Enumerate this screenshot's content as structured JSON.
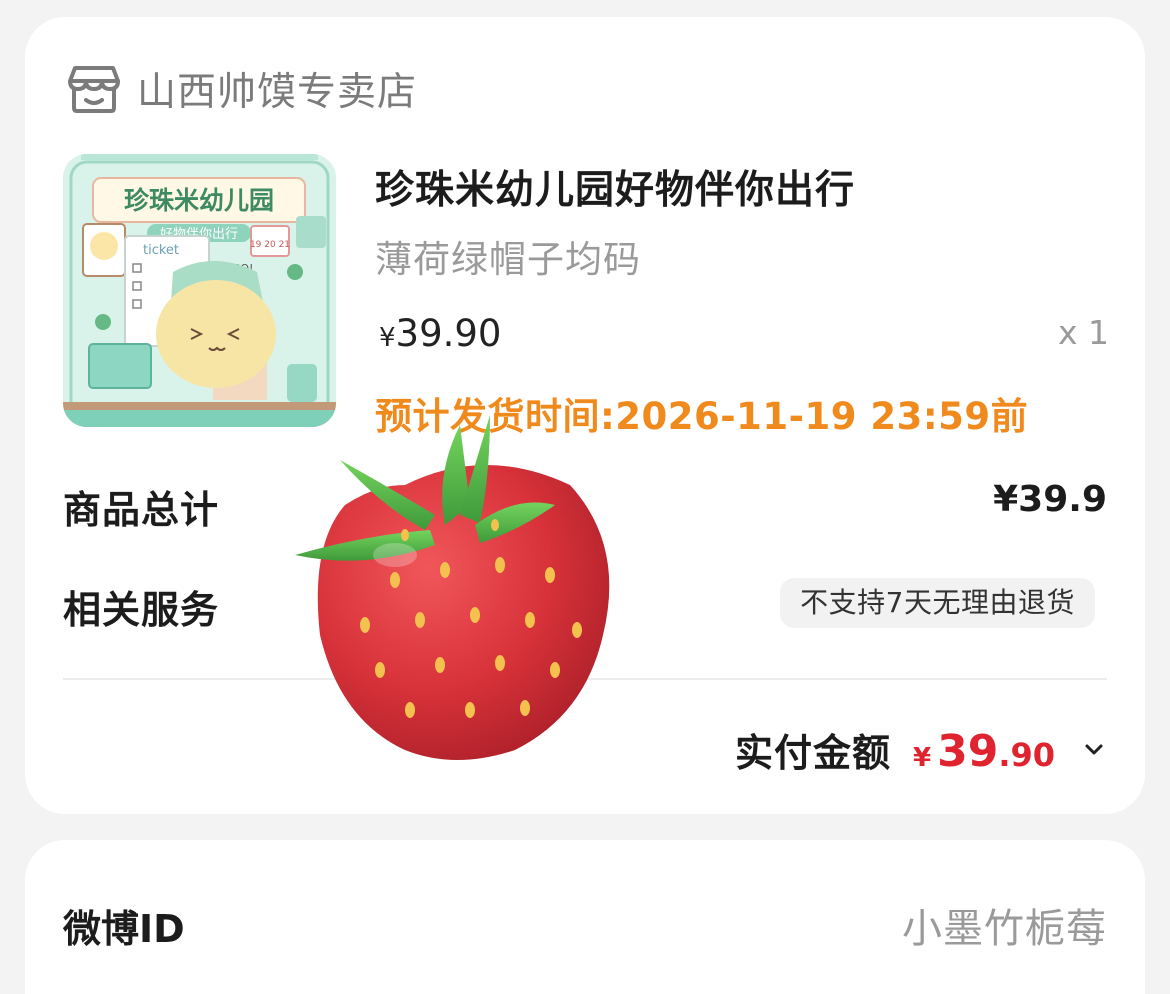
{
  "order": {
    "shop_name": "山西帅馍专卖店",
    "shop_icon": "store-icon",
    "product": {
      "title": "珍珠米幼儿园好物伴你出行",
      "spec": "薄荷绿帽子均码",
      "price_symbol": "¥",
      "price": "39.90",
      "quantity": "x 1",
      "ship_time": "预计发货时间:2026-11-19 23:59前",
      "thumb": {
        "heading": "珍珠米幼儿园",
        "subheading": "好物伴你出行",
        "ticket": "ticket",
        "bubble": "GOIGOIGO!",
        "date": "19 20 21"
      }
    },
    "total_label": "商品总计",
    "total_value": "¥39.9",
    "service_label": "相关服务",
    "service_badge": "不支持7天无理由退货",
    "paid_label": "实付金额",
    "paid_symbol": "¥",
    "paid_int": "39",
    "paid_dec": ".90",
    "expand_icon": "chevron-down-icon"
  },
  "weibo": {
    "label": "微博ID",
    "value": "小墨竹栀莓"
  },
  "sticker": "strawberry-emoji",
  "colors": {
    "accent_orange": "#f08a1c",
    "price_red": "#e0242f",
    "mint": "#cfeee2"
  }
}
